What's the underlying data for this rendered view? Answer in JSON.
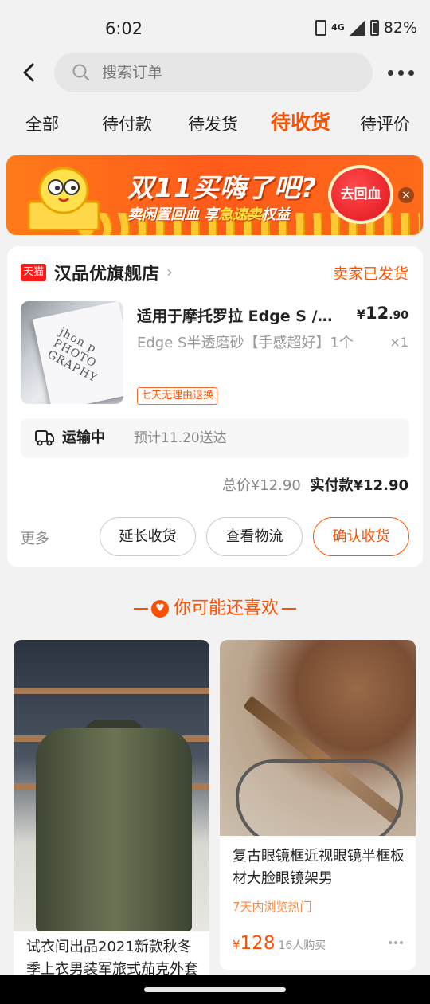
{
  "status_bar": {
    "time": "6:02",
    "network": "4G",
    "battery": "82%"
  },
  "header": {
    "search_placeholder": "搜索订单"
  },
  "tabs": [
    {
      "label": "全部"
    },
    {
      "label": "待付款"
    },
    {
      "label": "待发货"
    },
    {
      "label": "待收货",
      "active": true
    },
    {
      "label": "待评价"
    }
  ],
  "banner": {
    "title": "双11买嗨了吧?",
    "subtitle_a": "卖闲置回血 享",
    "subtitle_hl": "急速卖",
    "subtitle_b": "权益",
    "button": "去回血"
  },
  "order": {
    "platform_badge": "天猫",
    "shop_name": "汉品优旗舰店",
    "status": "卖家已发货",
    "product_title": "适用于摩托罗拉 Edge S / Edge S Pro 背膜",
    "spec": "Edge S半透磨砂【手感超好】1个",
    "price_symbol": "¥",
    "price_int": "12",
    "price_dec": ".90",
    "quantity": "×1",
    "tag": "七天无理由退换",
    "shipping_status": "运输中",
    "shipping_eta": "预计11.20送达",
    "total_label": "总价",
    "total_value": "¥12.90",
    "paid_label": "实付款",
    "paid_value": "¥12.90",
    "more": "更多",
    "buttons": {
      "extend": "延长收货",
      "logistics": "查看物流",
      "confirm": "确认收货"
    }
  },
  "recommend": {
    "title": "你可能还喜欢",
    "items": [
      {
        "title": "试衣间出品2021新款秋冬季上衣男装军旅式茄克外套"
      },
      {
        "title": "复古眼镜框近视眼镜半框板材大脸眼镜架男",
        "hot": "7天内浏览热门",
        "price": "128",
        "buyers": "16人购买"
      }
    ]
  },
  "colors": {
    "accent": "#ff5000",
    "tmall_red": "#ff1a1a"
  }
}
